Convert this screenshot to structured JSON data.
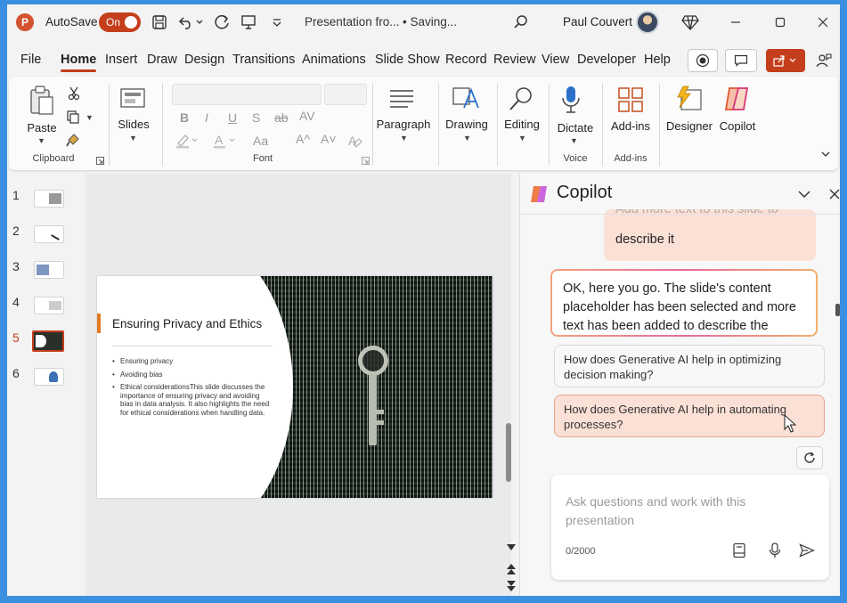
{
  "titlebar": {
    "app_logo": "P",
    "autosave_label": "AutoSave",
    "autosave_state": "On",
    "doc_title": "Presentation fro...",
    "doc_status": "• Saving...",
    "user_name": "Paul Couvert"
  },
  "tabs": [
    "File",
    "Home",
    "Insert",
    "Draw",
    "Design",
    "Transitions",
    "Animations",
    "Slide Show",
    "Record",
    "Review",
    "View",
    "Developer",
    "Help"
  ],
  "active_tab": "Home",
  "ribbon": {
    "paste": "Paste",
    "clipboard_group": "Clipboard",
    "slides": "Slides",
    "font_group": "Font",
    "paragraph": "Paragraph",
    "drawing": "Drawing",
    "editing": "Editing",
    "dictate": "Dictate",
    "voice_group": "Voice",
    "addins": "Add-ins",
    "addins_group": "Add-ins",
    "designer": "Designer",
    "copilot": "Copilot",
    "format_buttons": [
      "B",
      "I",
      "U",
      "S",
      "ab",
      "AV"
    ],
    "font_size_buttons": [
      "Aa",
      "A^",
      "A˅"
    ]
  },
  "thumbnails": {
    "numbers": [
      "1",
      "2",
      "3",
      "4",
      "5",
      "6"
    ],
    "active_index": 5
  },
  "slide": {
    "title": "Ensuring Privacy and Ethics",
    "bullets": [
      "Ensuring privacy",
      "Avoiding bias",
      "Ethical considerationsThis slide discusses the importance of ensuring privacy and avoiding bias in data analysis. It also highlights the need for ethical considerations when handling data."
    ]
  },
  "copilot": {
    "title": "Copilot",
    "user_message_faded": "Add more text to this slide to",
    "user_message": "describe it",
    "ai_message": "OK, here you go. The slide's content placeholder has been selected and more text has been added to describe the",
    "suggestions": [
      "How does Generative AI help in optimizing decision making?",
      "How does Generative AI help in automating processes?"
    ],
    "input_placeholder": "Ask questions and work with this presentation",
    "char_count": "0/2000"
  },
  "colors": {
    "accent": "#c43e1c",
    "suggestion_hover": "#fbe0d6",
    "slide_accent": "#e37a22"
  }
}
